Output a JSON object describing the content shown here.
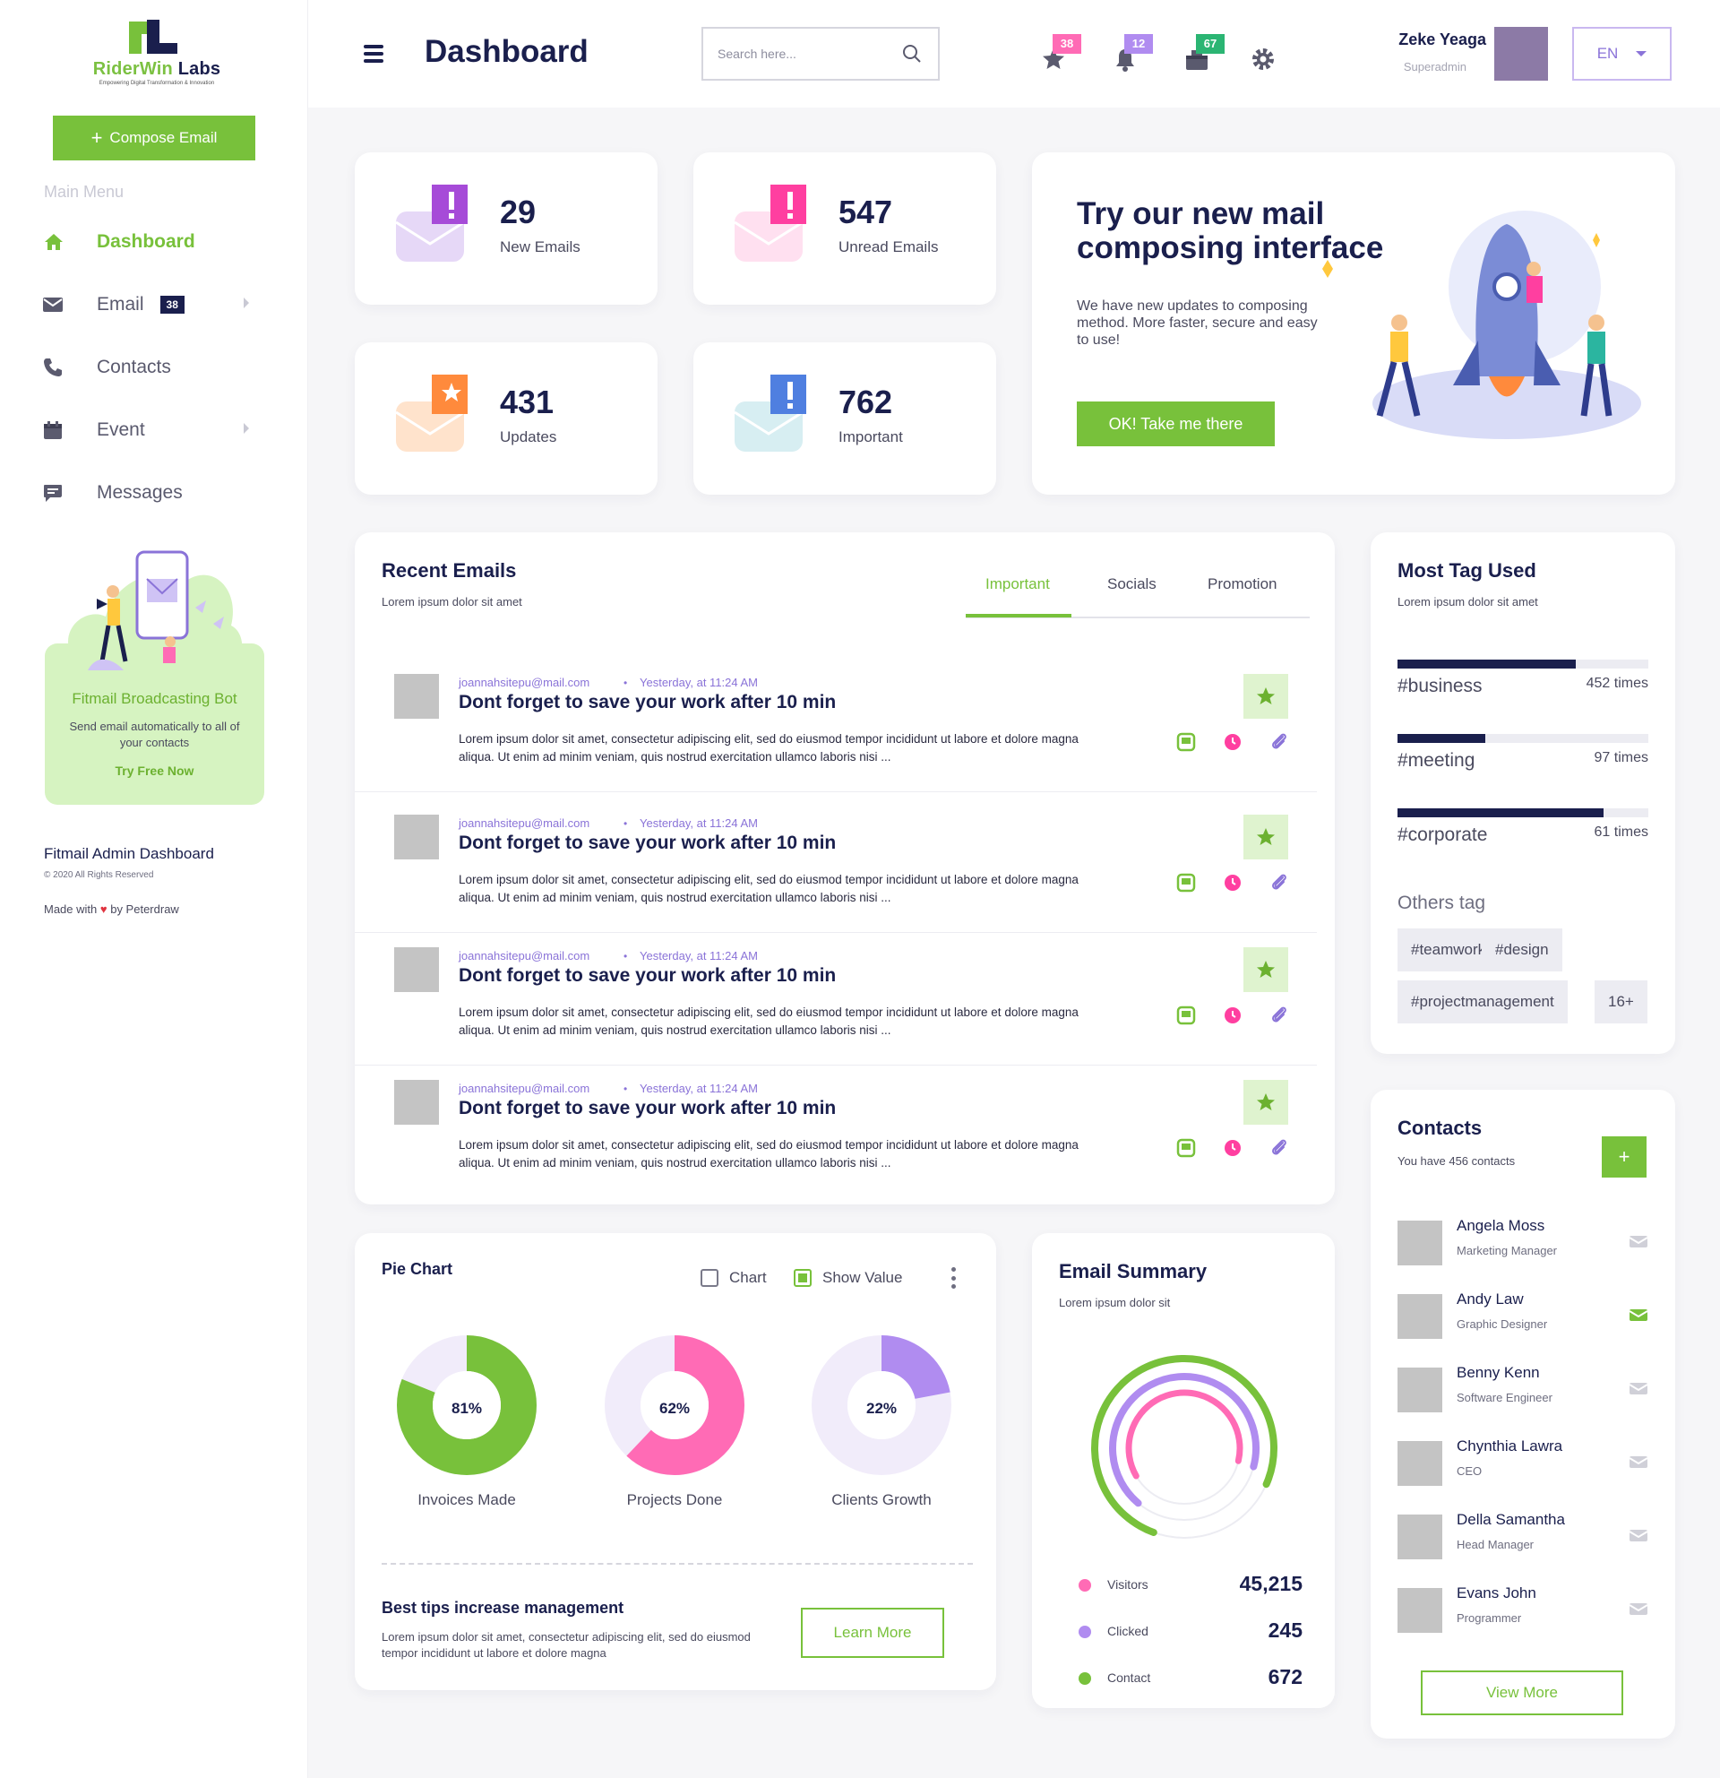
{
  "brand": {
    "name_part1": "RiderWin",
    "name_part2": "Labs",
    "tagline": "Empowering Digital Transformation & Innovation"
  },
  "sidebar": {
    "compose_label": "Compose Email",
    "menu_title": "Main Menu",
    "items": [
      {
        "label": "Dashboard",
        "icon": "home-icon",
        "active": true
      },
      {
        "label": "Email",
        "icon": "envelope-icon",
        "badge": "38"
      },
      {
        "label": "Contacts",
        "icon": "phone-icon"
      },
      {
        "label": "Event",
        "icon": "calendar-icon"
      },
      {
        "label": "Messages",
        "icon": "chat-icon"
      }
    ],
    "promo": {
      "title": "Fitmail Broadcasting Bot",
      "desc": "Send email automatically to all of your contacts",
      "link": "Try Free Now"
    },
    "footer": {
      "title": "Fitmail Admin Dashboard",
      "copyright": "© 2020 All Rights Reserved",
      "made_prefix": "Made with",
      "made_suffix": "by Peterdraw"
    }
  },
  "header": {
    "title": "Dashboard",
    "search_placeholder": "Search here...",
    "badges": {
      "favorites": "38",
      "notifications": "12",
      "inbox": "67"
    },
    "user_name": "Zeke Yeaga",
    "user_role": "Superadmin",
    "language": "EN"
  },
  "stats": [
    {
      "value": "29",
      "label": "New Emails"
    },
    {
      "value": "547",
      "label": "Unread Emails"
    },
    {
      "value": "431",
      "label": "Updates"
    },
    {
      "value": "762",
      "label": "Important"
    }
  ],
  "promo_main": {
    "title": "Try our new mail composing interface",
    "desc": "We have new updates to composing method. More faster, secure and easy to use!",
    "button": "OK! Take me there"
  },
  "recent_emails": {
    "title": "Recent Emails",
    "subtitle": "Lorem ipsum dolor sit amet",
    "tabs": [
      "Important",
      "Socials",
      "Promotion"
    ],
    "items": [
      {
        "from": "joannahsitepu@mail.com",
        "time": "Yesterday, at 11:24 AM",
        "subject": "Dont forget to save your work after 10 min",
        "body": "Lorem ipsum dolor sit amet, consectetur adipiscing elit, sed do eiusmod tempor incididunt ut labore et dolore magna aliqua. Ut enim ad minim veniam, quis nostrud exercitation ullamco laboris nisi ..."
      },
      {
        "from": "joannahsitepu@mail.com",
        "time": "Yesterday, at 11:24 AM",
        "subject": "Dont forget to save your work after 10 min",
        "body": "Lorem ipsum dolor sit amet, consectetur adipiscing elit, sed do eiusmod tempor incididunt ut labore et dolore magna aliqua. Ut enim ad minim veniam, quis nostrud exercitation ullamco laboris nisi ..."
      },
      {
        "from": "joannahsitepu@mail.com",
        "time": "Yesterday, at 11:24 AM",
        "subject": "Dont forget to save your work after 10 min",
        "body": "Lorem ipsum dolor sit amet, consectetur adipiscing elit, sed do eiusmod tempor incididunt ut labore et dolore magna aliqua. Ut enim ad minim veniam, quis nostrud exercitation ullamco laboris nisi ..."
      },
      {
        "from": "joannahsitepu@mail.com",
        "time": "Yesterday, at 11:24 AM",
        "subject": "Dont forget to save your work after 10 min",
        "body": "Lorem ipsum dolor sit amet, consectetur adipiscing elit, sed do eiusmod tempor incididunt ut labore et dolore magna aliqua. Ut enim ad minim veniam, quis nostrud exercitation ullamco laboris nisi ..."
      }
    ]
  },
  "tags": {
    "title": "Most Tag Used",
    "subtitle": "Lorem ipsum dolor sit amet",
    "items": [
      {
        "name": "#business",
        "count": "452 times",
        "share": 0.71
      },
      {
        "name": "#meeting",
        "count": "97 times",
        "share": 0.35
      },
      {
        "name": "#corporate",
        "count": "61 times",
        "share": 0.82
      }
    ],
    "others_title": "Others tag",
    "others": [
      "#teamwork",
      "#design",
      "#projectmanagement",
      "16+"
    ]
  },
  "contacts": {
    "title": "Contacts",
    "subtitle": "You have 456 contacts",
    "add_label": "+",
    "items": [
      {
        "name": "Angela Moss",
        "role": "Marketing Manager"
      },
      {
        "name": "Andy Law",
        "role": "Graphic Designer"
      },
      {
        "name": "Benny Kenn",
        "role": "Software Engineer"
      },
      {
        "name": "Chynthia Lawra",
        "role": "CEO"
      },
      {
        "name": "Della Samantha",
        "role": "Head Manager"
      },
      {
        "name": "Evans John",
        "role": "Programmer"
      }
    ],
    "view_more": "View More"
  },
  "pie_card": {
    "title": "Pie Chart",
    "toggle_chart": "Chart",
    "toggle_value": "Show Value",
    "tips_title": "Best tips increase management",
    "tips_desc": "Lorem ipsum dolor sit amet, consectetur adipiscing elit, sed do eiusmod tempor incididunt ut labore et dolore magna",
    "learn_more": "Learn More"
  },
  "email_summary": {
    "title": "Email Summary",
    "subtitle": "Lorem ipsum dolor sit",
    "legend": [
      {
        "name": "Visitors",
        "value": "45,215",
        "color": "#ff6bb5"
      },
      {
        "name": "Clicked",
        "value": "245",
        "color": "#b08cf0"
      },
      {
        "name": "Contact",
        "value": "672",
        "color": "#78c13b"
      }
    ]
  },
  "colors": {
    "accent": "#78c13b",
    "navy": "#1a1f4d",
    "pink": "#ff6bb5",
    "purple": "#b08cf0"
  },
  "chart_data": [
    {
      "type": "pie",
      "series": [
        {
          "name": "Invoices Made",
          "value": 81,
          "label": "81%",
          "color": "#78c13b"
        },
        {
          "name": "Projects Done",
          "value": 62,
          "label": "62%",
          "color": "#ff6bb5"
        },
        {
          "name": "Clients Growth",
          "value": 22,
          "label": "22%",
          "color": "#b08cf0"
        }
      ]
    },
    {
      "type": "radial",
      "series": [
        {
          "name": "Contact",
          "fraction": 0.76,
          "color": "#78c13b"
        },
        {
          "name": "Clicked",
          "fraction": 0.68,
          "color": "#b08cf0"
        },
        {
          "name": "Visitors",
          "fraction": 0.62,
          "color": "#ff6bb5"
        }
      ]
    }
  ]
}
